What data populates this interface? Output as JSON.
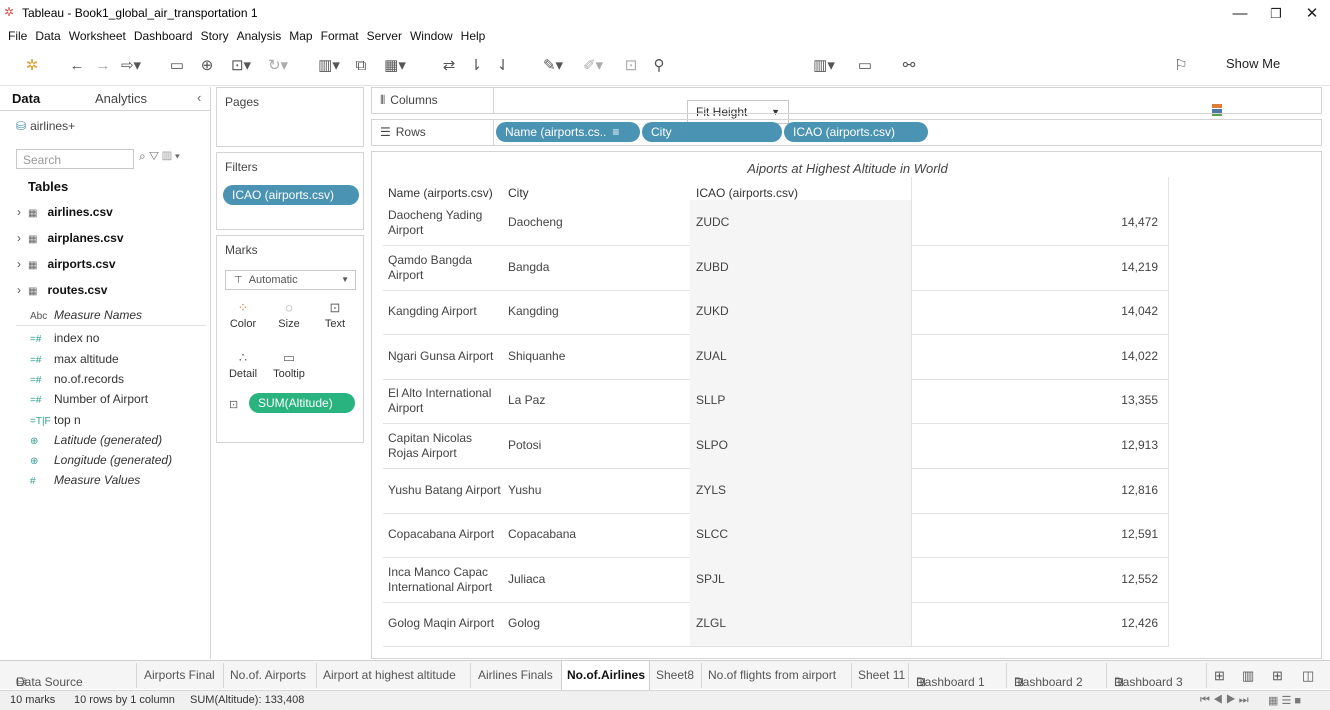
{
  "window": {
    "title": "Tableau - Book1_global_air_transportation 1"
  },
  "menu": [
    "File",
    "Data",
    "Worksheet",
    "Dashboard",
    "Story",
    "Analysis",
    "Map",
    "Format",
    "Server",
    "Window",
    "Help"
  ],
  "toolbar": {
    "fit_label": "Fit Height",
    "show_me": "Show Me"
  },
  "data_pane": {
    "tab_data": "Data",
    "tab_analytics": "Analytics",
    "datasource": "airlines+",
    "search_placeholder": "Search",
    "tables_header": "Tables",
    "tables": [
      "airlines.csv",
      "airplanes.csv",
      "airports.csv",
      "routes.csv"
    ],
    "fields": [
      {
        "icon": "Abc",
        "label": "Measure Names",
        "italic": true
      },
      {
        "icon": "=#",
        "label": "index no",
        "italic": false
      },
      {
        "icon": "=#",
        "label": "max altitude",
        "italic": false
      },
      {
        "icon": "=#",
        "label": "no.of.records",
        "italic": false
      },
      {
        "icon": "=#",
        "label": "Number of Airport",
        "italic": false
      },
      {
        "icon": "=T|F",
        "label": "top n",
        "italic": false
      },
      {
        "icon": "⊕",
        "label": "Latitude (generated)",
        "italic": true
      },
      {
        "icon": "⊕",
        "label": "Longitude (generated)",
        "italic": true
      },
      {
        "icon": "#",
        "label": "Measure Values",
        "italic": true
      }
    ]
  },
  "shelves": {
    "pages": "Pages",
    "filters": "Filters",
    "filter_pill": "ICAO (airports.csv)",
    "marks": "Marks",
    "mark_type": "Automatic",
    "mark_cards": [
      "Color",
      "Size",
      "Text",
      "Detail",
      "Tooltip"
    ],
    "sum_pill": "SUM(Altitude)",
    "columns": "Columns",
    "rows": "Rows",
    "row_pills": [
      "Name (airports.cs..",
      "City",
      "ICAO (airports.csv)"
    ]
  },
  "view": {
    "title": "Aiports at Highest Altitude in World",
    "headers": [
      "Name (airports.csv)",
      "City",
      "ICAO (airports.csv)"
    ],
    "rows": [
      {
        "name": "Daocheng Yading Airport",
        "city": "Daocheng",
        "icao": "ZUDC",
        "value": "14,472"
      },
      {
        "name": "Qamdo Bangda Airport",
        "city": "Bangda",
        "icao": "ZUBD",
        "value": "14,219"
      },
      {
        "name": "Kangding Airport",
        "city": "Kangding",
        "icao": "ZUKD",
        "value": "14,042"
      },
      {
        "name": "Ngari Gunsa Airport",
        "city": "Shiquanhe",
        "icao": "ZUAL",
        "value": "14,022"
      },
      {
        "name": "El Alto International Airport",
        "city": "La Paz",
        "icao": "SLLP",
        "value": "13,355"
      },
      {
        "name": "Capitan Nicolas Rojas Airport",
        "city": "Potosi",
        "icao": "SLPO",
        "value": "12,913"
      },
      {
        "name": "Yushu Batang Airport",
        "city": "Yushu",
        "icao": "ZYLS",
        "value": "12,816"
      },
      {
        "name": "Copacabana Airport",
        "city": "Copacabana",
        "icao": "SLCC",
        "value": "12,591"
      },
      {
        "name": "Inca Manco Capac International Airport",
        "city": "Juliaca",
        "icao": "SPJL",
        "value": "12,552"
      },
      {
        "name": "Golog Maqin Airport",
        "city": "Golog",
        "icao": "ZLGL",
        "value": "12,426"
      }
    ]
  },
  "sheet_tabs": [
    "Data Source",
    "Airports Final",
    "No.of. Airports",
    "Airport at highest altitude",
    "Airlines Finals",
    "No.of.Airlines",
    "Sheet8",
    "No.of flights from airport",
    "Sheet 11",
    "Dashboard 1",
    "Dashboard 2",
    "Dashboard 3"
  ],
  "active_tab": "No.of.Airlines",
  "status": {
    "marks": "10 marks",
    "dims": "10 rows by 1 column",
    "sum": "SUM(Altitude): 133,408"
  },
  "colors": {
    "pill_blue": "#4a93b3",
    "pill_green": "#28b37f"
  }
}
